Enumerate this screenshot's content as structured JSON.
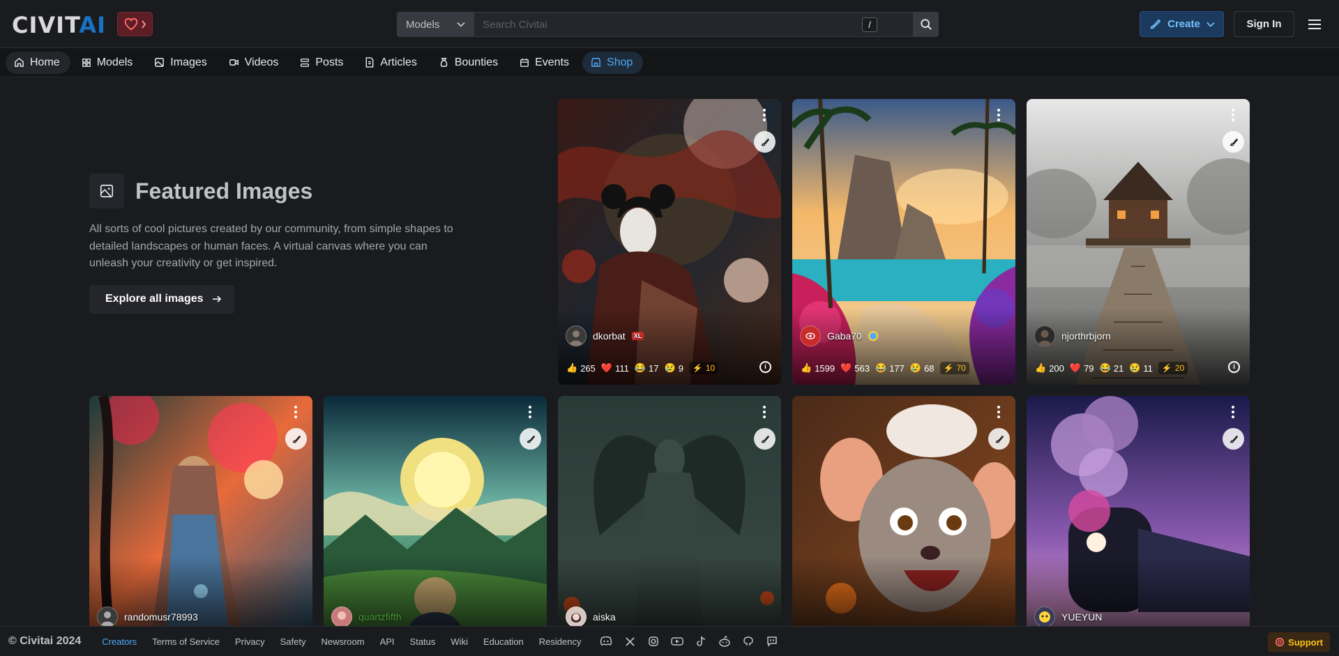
{
  "header": {
    "logo_main": "CIVIT",
    "logo_accent": "AI",
    "search_select": "Models",
    "search_placeholder": "Search Civitai",
    "slash_key": "/",
    "create_label": "Create",
    "signin_label": "Sign In"
  },
  "nav": [
    {
      "label": "Home",
      "icon": "home-icon"
    },
    {
      "label": "Models",
      "icon": "grid-icon"
    },
    {
      "label": "Images",
      "icon": "image-icon"
    },
    {
      "label": "Videos",
      "icon": "video-icon"
    },
    {
      "label": "Posts",
      "icon": "posts-icon"
    },
    {
      "label": "Articles",
      "icon": "article-icon"
    },
    {
      "label": "Bounties",
      "icon": "moneybag-icon"
    },
    {
      "label": "Events",
      "icon": "calendar-icon"
    },
    {
      "label": "Shop",
      "icon": "shop-icon"
    }
  ],
  "featured": {
    "title": "Featured Images",
    "description": "All sorts of cool pictures created by our community, from simple shapes to detailed landscapes or human faces. A virtual canvas where you can unleash your creativity or get inspired.",
    "button": "Explore all images"
  },
  "cards": [
    {
      "user": "dkorbat",
      "badge": "XL",
      "reactions": {
        "like": "265",
        "heart": "111",
        "laugh": "17",
        "cry": "9",
        "buzz": "10"
      }
    },
    {
      "user": "Gaba70",
      "reactions": {
        "like": "1599",
        "heart": "563",
        "laugh": "177",
        "cry": "68",
        "buzz": "70"
      }
    },
    {
      "user": "njorthrbjorn",
      "reactions": {
        "like": "200",
        "heart": "79",
        "laugh": "21",
        "cry": "11",
        "buzz": "20"
      }
    },
    {
      "user": "randomusr78993"
    },
    {
      "user": "quartzfifth"
    },
    {
      "user": "aiska"
    },
    {
      "user": ""
    },
    {
      "user": "YUEYUN"
    }
  ],
  "footer": {
    "copyright": "© Civitai 2024",
    "links": [
      "Creators",
      "Terms of Service",
      "Privacy",
      "Safety",
      "Newsroom",
      "API",
      "Status",
      "Wiki",
      "Education",
      "Residency"
    ],
    "social_icons": [
      "discord-icon",
      "x-icon",
      "instagram-icon",
      "youtube-icon",
      "tiktok-icon",
      "reddit-icon",
      "github-icon",
      "chat-icon"
    ],
    "support_label": "Support"
  },
  "colors": {
    "accent": "#4dabf7",
    "brand_blue": "#1971c2",
    "background": "#1a1b1e",
    "buzz": "#fcc419"
  }
}
